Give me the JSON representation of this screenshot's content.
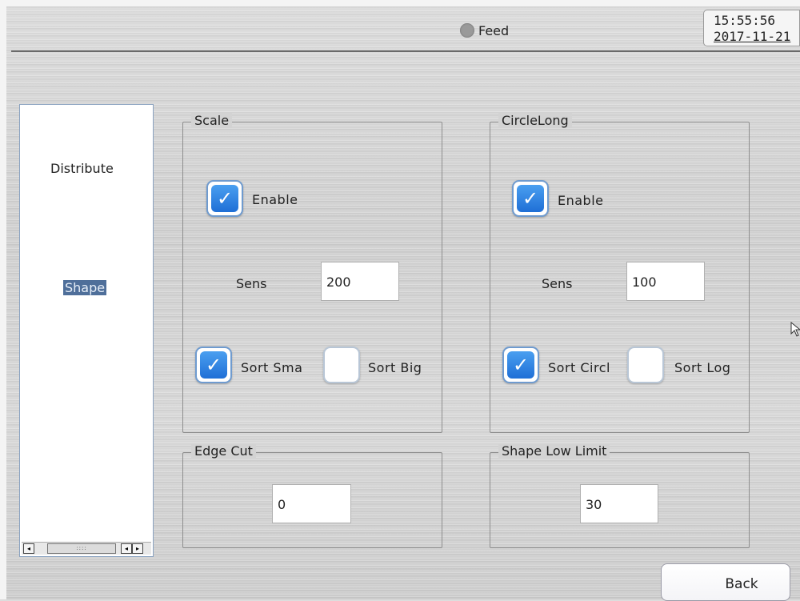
{
  "header": {
    "feed_label": "Feed",
    "time": "15:55:56",
    "date": "2017-11-21"
  },
  "sidebar": {
    "items": [
      {
        "label": "Distribute",
        "selected": false
      },
      {
        "label": "Shape",
        "selected": true
      }
    ],
    "scrollbar": {
      "thumb_label": "::::"
    }
  },
  "scale": {
    "title": "Scale",
    "enable_label": "Enable",
    "enable_checked": true,
    "sens_label": "Sens",
    "sens_value": "200",
    "sort_small_label": "Sort Sma",
    "sort_small_checked": true,
    "sort_big_label": "Sort Big",
    "sort_big_checked": false
  },
  "circle_long": {
    "title": "CircleLong",
    "enable_label": "Enable",
    "enable_checked": true,
    "sens_label": "Sens",
    "sens_value": "100",
    "sort_circle_label": "Sort Circl",
    "sort_circle_checked": true,
    "sort_long_label": "Sort Log",
    "sort_long_checked": false
  },
  "edge_cut": {
    "title": "Edge Cut",
    "value": "0"
  },
  "shape_low_limit": {
    "title": "Shape Low Limit",
    "value": "30"
  },
  "footer": {
    "back_label": "Back"
  },
  "colors": {
    "check_blue": "#2f86e4",
    "selected_bg": "#4f6f9a",
    "feed_dot": "#9a9a9a"
  }
}
